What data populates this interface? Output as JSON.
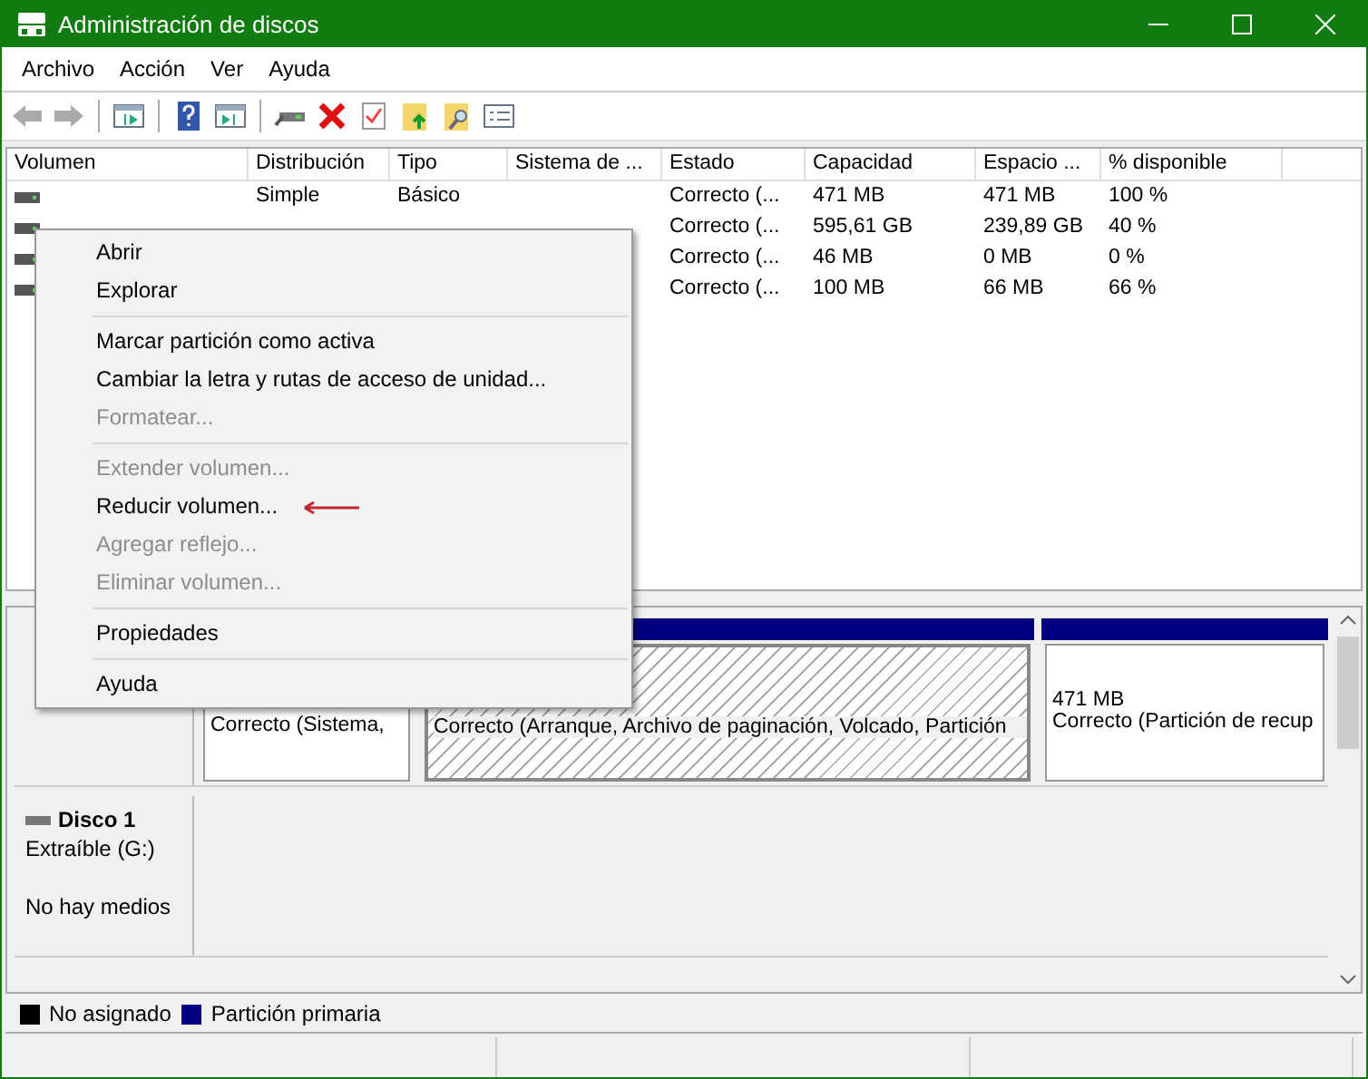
{
  "window": {
    "title": "Administración de discos"
  },
  "menu_bar": [
    "Archivo",
    "Acción",
    "Ver",
    "Ayuda"
  ],
  "table": {
    "columns": [
      "Volumen",
      "Distribución",
      "Tipo",
      "Sistema de ...",
      "Estado",
      "Capacidad",
      "Espacio ...",
      "% disponible"
    ],
    "rows": [
      {
        "layout": "Simple",
        "type": "Básico",
        "status": "Correcto (...",
        "capacity": "471 MB",
        "free_space": "471 MB",
        "percent_free": "100 %"
      },
      {
        "status": "Correcto (...",
        "capacity": "595,61 GB",
        "free_space": "239,89 GB",
        "percent_free": "40 %"
      },
      {
        "status": "Correcto (...",
        "capacity": "46 MB",
        "free_space": "0 MB",
        "percent_free": "0 %"
      },
      {
        "status": "Correcto (...",
        "capacity": "100 MB",
        "free_space": "66 MB",
        "percent_free": "66 %"
      }
    ]
  },
  "disks": [
    {
      "partitions": [
        {
          "status": "Correcto (Sistema,",
          "selected": false
        },
        {
          "status": "Correcto (Arranque, Archivo de paginación, Volcado, Partición",
          "selected": true
        },
        {
          "size": "471 MB",
          "status": "Correcto (Partición de recup",
          "selected": false
        }
      ]
    },
    {
      "name": "Disco 1",
      "type": "Extraíble (G:)",
      "status": "No hay medios"
    }
  ],
  "legend": [
    {
      "label": "No asignado",
      "color": "#000000"
    },
    {
      "label": "Partición primaria",
      "color": "#000080"
    }
  ],
  "context_menu": [
    {
      "kind": "item",
      "label": "Abrir",
      "disabled": false,
      "marked": false
    },
    {
      "kind": "item",
      "label": "Explorar",
      "disabled": false,
      "marked": false
    },
    {
      "kind": "separator"
    },
    {
      "kind": "item",
      "label": "Marcar partición como activa",
      "disabled": false,
      "marked": false
    },
    {
      "kind": "item",
      "label": "Cambiar la letra y rutas de acceso de unidad...",
      "disabled": false,
      "marked": false
    },
    {
      "kind": "item",
      "label": "Formatear...",
      "disabled": true,
      "marked": false
    },
    {
      "kind": "separator"
    },
    {
      "kind": "item",
      "label": "Extender volumen...",
      "disabled": true,
      "marked": false
    },
    {
      "kind": "item",
      "label": "Reducir volumen...",
      "disabled": false,
      "marked": true
    },
    {
      "kind": "item",
      "label": "Agregar reflejo...",
      "disabled": true,
      "marked": false
    },
    {
      "kind": "item",
      "label": "Eliminar volumen...",
      "disabled": true,
      "marked": false
    },
    {
      "kind": "separator"
    },
    {
      "kind": "item",
      "label": "Propiedades",
      "disabled": false,
      "marked": false
    },
    {
      "kind": "separator"
    },
    {
      "kind": "item",
      "label": "Ayuda",
      "disabled": false,
      "marked": false
    }
  ]
}
